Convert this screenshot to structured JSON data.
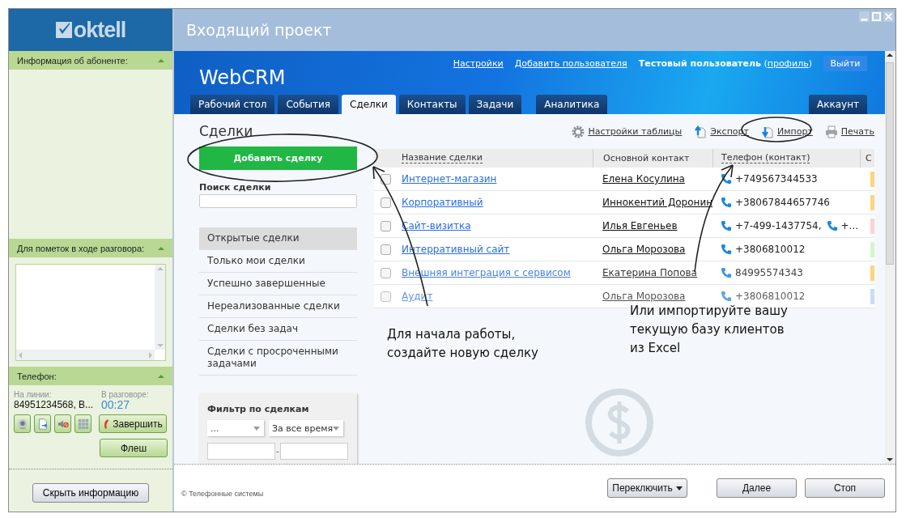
{
  "window": {
    "title": "Входящий проект",
    "logo": "oktell"
  },
  "left_panel": {
    "subscriber_header": "Информация об абоненте:",
    "notes_header": "Для пометок в ходе разговора:",
    "phone_header": "Телефон:",
    "line_label": "На линии:",
    "line_value": "84951234568,  В...",
    "talk_label": "В разговоре:",
    "talk_time": "00:27",
    "end_button": "Завершить",
    "flash_button": "Флеш",
    "hide_button": "Скрыть информацию"
  },
  "crm": {
    "title": "WebCRM",
    "links": [
      "Настройки",
      "Добавить пользователя"
    ],
    "user": {
      "name": "Тестовый пользователь",
      "profile_prefix": "(",
      "profile_link": "профиль",
      "profile_suffix": ")"
    },
    "logout_button": "Выйти",
    "tabs": [
      {
        "label": "Рабочий стол",
        "selected": false,
        "kind": "tab"
      },
      {
        "label": "События",
        "selected": false,
        "kind": "tab"
      },
      {
        "label": "Сделки",
        "selected": true,
        "kind": "tab"
      },
      {
        "label": "Контакты",
        "selected": false,
        "kind": "tab"
      },
      {
        "label": "Задачи",
        "selected": false,
        "kind": "tab"
      },
      {
        "label": "Аналитика",
        "selected": false,
        "kind": "spaced"
      }
    ],
    "account_tab": {
      "label": "Аккаунт",
      "selected": false
    },
    "page_title": "Сделки",
    "add_button": "Добавить сделку",
    "search_label": "Поиск сделки",
    "deal_lists": [
      {
        "label": "Открытые сделки",
        "selected": true
      },
      {
        "label": "Только мои сделки",
        "selected": false
      },
      {
        "label": "Успешно завершенные",
        "selected": false
      },
      {
        "label": "Нереализованные сделки",
        "selected": false
      },
      {
        "label": "Сделки без задач",
        "selected": false
      },
      {
        "label": "Сделки с просроченными задачами",
        "selected": false
      }
    ],
    "filter": {
      "title": "Фильтр по сделкам",
      "select_1": "...",
      "select_2": "За все время",
      "range_separator": "-"
    },
    "toolbar": [
      {
        "label": "Настройки таблицы",
        "kind": "settings"
      },
      {
        "label": "Экспорт",
        "kind": "export"
      },
      {
        "label": "Импорт",
        "kind": "import"
      },
      {
        "label": "Печать",
        "kind": "print"
      }
    ],
    "table": {
      "columns": [
        {
          "label": "Название сделки",
          "sortable": true
        },
        {
          "label": "Основной контакт",
          "sortable": false
        },
        {
          "label": "Телефон (контакт)",
          "sortable": true
        },
        {
          "label": "С",
          "sortable": false
        }
      ],
      "rows": [
        {
          "name": "Интернет-магазин",
          "contact": "Елена Косулина",
          "phones": [
            "+749567344533"
          ],
          "color": "#ffd47c",
          "checked": false
        },
        {
          "name": "Корпоративный",
          "contact": "Иннокентий Доронин",
          "phones": [
            "+38067844657746"
          ],
          "color": "#ffd47c",
          "checked": false
        },
        {
          "name": "Сайт-визитка",
          "contact": "Илья Евгеньев",
          "phones": [
            "+7-499-1437754,",
            "+..."
          ],
          "color": "#ffd2d2",
          "checked": false
        },
        {
          "name": "Интерративный сайт",
          "contact": "Ольга Морозова",
          "phones": [
            "+3806810012"
          ],
          "color": "#d4f5cf",
          "checked": false
        },
        {
          "name": "Внешняя интеграция с сервисом",
          "contact": "Екатерина Попова",
          "phones": [
            "84995574343"
          ],
          "color": "#ffd47c",
          "checked": false
        },
        {
          "name": "Аудит",
          "contact": "Ольга Морозова",
          "phones": [
            "+3806810012"
          ],
          "color": "#c9def6",
          "checked": false
        }
      ]
    }
  },
  "annotations": [
    {
      "text": "Для начала работы,\nсоздайте новую сделку",
      "kind": "left"
    },
    {
      "text": "Или импортируйте вашу\nтекущую базу клиентов\nиз Excel",
      "kind": "right"
    }
  ],
  "footer": {
    "copyright": "© Телефонные системы",
    "switch_button": "Переключить",
    "next_button": "Далее",
    "stop_button": "Стоп"
  }
}
